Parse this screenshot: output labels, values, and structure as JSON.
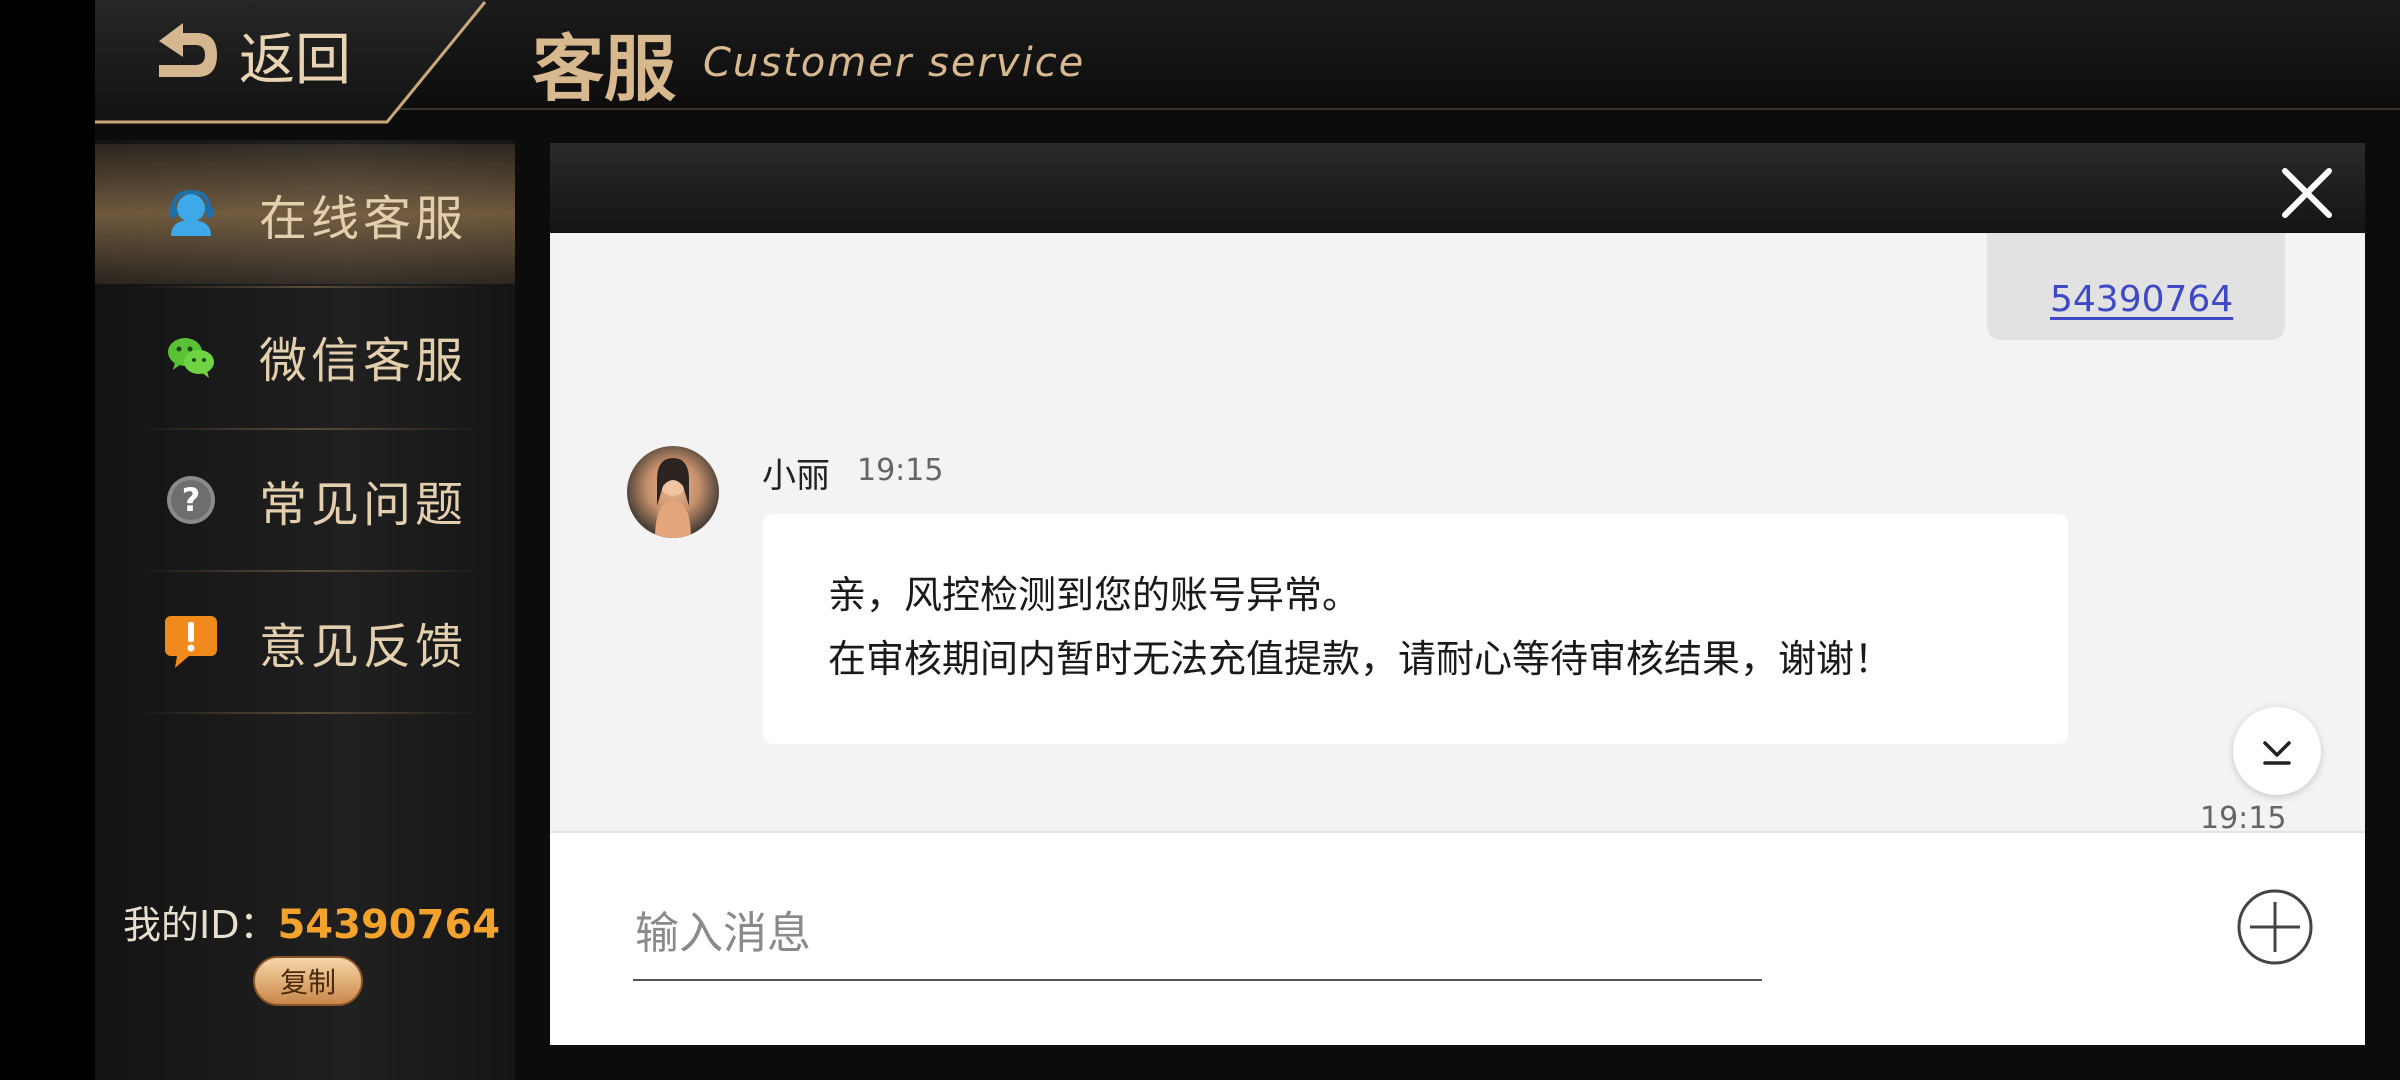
{
  "header": {
    "back_label": "返回",
    "title": "客服",
    "subtitle": "Customer service"
  },
  "sidebar": {
    "items": [
      {
        "label": "在线客服",
        "icon": "headset-icon",
        "active": true
      },
      {
        "label": "微信客服",
        "icon": "wechat-icon",
        "active": false
      },
      {
        "label": "常见问题",
        "icon": "question-icon",
        "active": false
      },
      {
        "label": "意见反馈",
        "icon": "exclamation-icon",
        "active": false
      }
    ],
    "my_id_label": "我的ID：",
    "my_id_value": "54390764",
    "copy_label": "复制"
  },
  "chat": {
    "sent_message": "54390764",
    "agent": {
      "name": "小丽",
      "time": "19:15"
    },
    "message_lines": [
      "亲，风控检测到您的账号异常。",
      "在审核期间内暂时无法充值提款，请耐心等待审核结果，谢谢！"
    ],
    "timestamp": "19:15",
    "input_placeholder": "输入消息"
  },
  "colors": {
    "gold": "#d8b88e",
    "id_orange": "#f3a22c",
    "link_blue": "#3f49c8"
  }
}
